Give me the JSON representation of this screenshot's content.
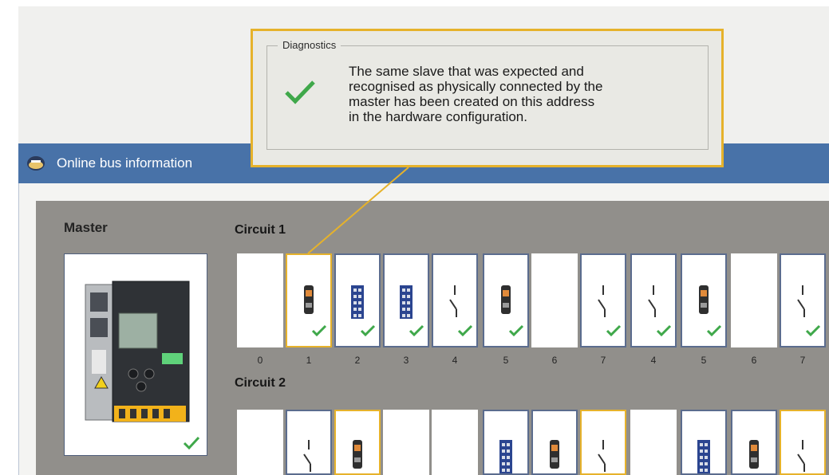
{
  "window": {
    "title": "Online bus information",
    "logo": "bus-logo-icon"
  },
  "master": {
    "label": "Master",
    "device_icon": "gateway-device-icon",
    "status_icon": "check-icon"
  },
  "circuit1": {
    "label": "Circuit 1",
    "slots": [
      {
        "address": "0",
        "device": "empty",
        "status": "none",
        "selected": false
      },
      {
        "address": "1",
        "device": "sensor-module-icon",
        "status": "check-icon",
        "selected": true
      },
      {
        "address": "2",
        "device": "io-module-icon",
        "status": "check-icon",
        "selected": false
      },
      {
        "address": "3",
        "device": "io-module-icon",
        "status": "check-icon",
        "selected": false
      },
      {
        "address": "4",
        "device": "switch-icon",
        "status": "check-icon",
        "selected": false
      },
      {
        "address": "5",
        "device": "sensor-module-icon",
        "status": "check-icon",
        "selected": false
      },
      {
        "address": "6",
        "device": "empty",
        "status": "none",
        "selected": false
      },
      {
        "address": "7",
        "device": "switch-icon",
        "status": "check-icon",
        "selected": false
      },
      {
        "address": "4",
        "device": "switch-icon",
        "status": "check-icon",
        "selected": false
      },
      {
        "address": "5",
        "device": "sensor-module-icon",
        "status": "check-icon",
        "selected": false
      },
      {
        "address": "6",
        "device": "empty",
        "status": "none",
        "selected": false
      },
      {
        "address": "7",
        "device": "switch-icon",
        "status": "check-icon",
        "selected": false
      }
    ]
  },
  "circuit2": {
    "label": "Circuit 2",
    "slots": [
      {
        "device": "empty",
        "selected": false
      },
      {
        "device": "switch-icon",
        "selected": false
      },
      {
        "device": "sensor-module-icon",
        "selected": true
      },
      {
        "device": "empty",
        "selected": false
      },
      {
        "device": "empty",
        "selected": false
      },
      {
        "device": "io-module-icon",
        "selected": false
      },
      {
        "device": "sensor-module-icon",
        "selected": false
      },
      {
        "device": "switch-icon",
        "selected": true
      },
      {
        "device": "empty",
        "selected": false
      },
      {
        "device": "io-module-icon",
        "selected": false
      },
      {
        "device": "sensor-module-icon",
        "selected": false
      },
      {
        "device": "switch-icon",
        "selected": true
      }
    ]
  },
  "diagnostics": {
    "legend": "Diagnostics",
    "message_line1": "The same slave that was expected and",
    "message_line2": "recognised as physically connected by the",
    "message_line3": "master has been created on this address",
    "message_line4": "in the hardware configuration.",
    "status_icon": "check-icon"
  },
  "colors": {
    "title_bar": "#4872a8",
    "highlight": "#e6b22b",
    "check": "#3fa84a",
    "panel": "#918f8b"
  }
}
